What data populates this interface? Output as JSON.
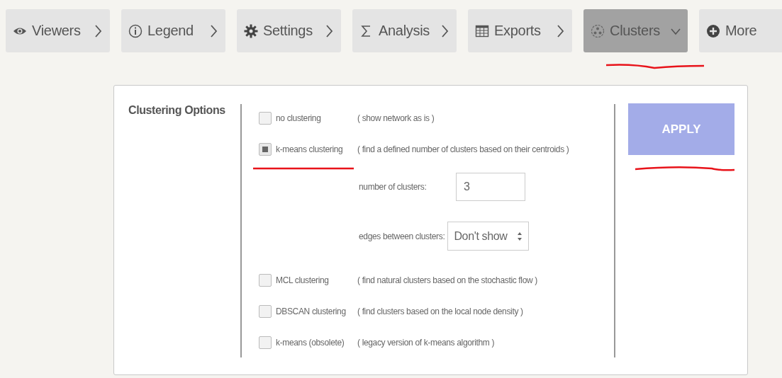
{
  "tabs": [
    {
      "label": "Viewers",
      "selected": false,
      "expanded": false
    },
    {
      "label": "Legend",
      "selected": false,
      "expanded": false
    },
    {
      "label": "Settings",
      "selected": false,
      "expanded": false
    },
    {
      "label": "Analysis",
      "selected": false,
      "expanded": false
    },
    {
      "label": "Exports",
      "selected": false,
      "expanded": false
    },
    {
      "label": "Clusters",
      "selected": true,
      "expanded": true
    },
    {
      "label": "More",
      "selected": false
    }
  ],
  "panel": {
    "title": "Clustering Options",
    "options": [
      {
        "label": "no clustering",
        "description": "( show network as is )",
        "checked": false
      },
      {
        "label": "k-means clustering",
        "description": "( find a defined number of clusters based on their centroids )",
        "checked": true,
        "settings": [
          {
            "kind": "input",
            "label": "number of clusters:",
            "value": "3"
          },
          {
            "kind": "select",
            "label": "edges between clusters:",
            "value": "Don't show"
          }
        ]
      },
      {
        "label": "MCL clustering",
        "description": "( find natural clusters based on the stochastic flow )",
        "checked": false
      },
      {
        "label": "DBSCAN clustering",
        "description": "( find clusters based on the local node density )",
        "checked": false
      },
      {
        "label": "k-means (obsolete)",
        "description": "( legacy version of k-means algorithm )",
        "checked": false
      }
    ],
    "apply_button": "APPLY"
  }
}
